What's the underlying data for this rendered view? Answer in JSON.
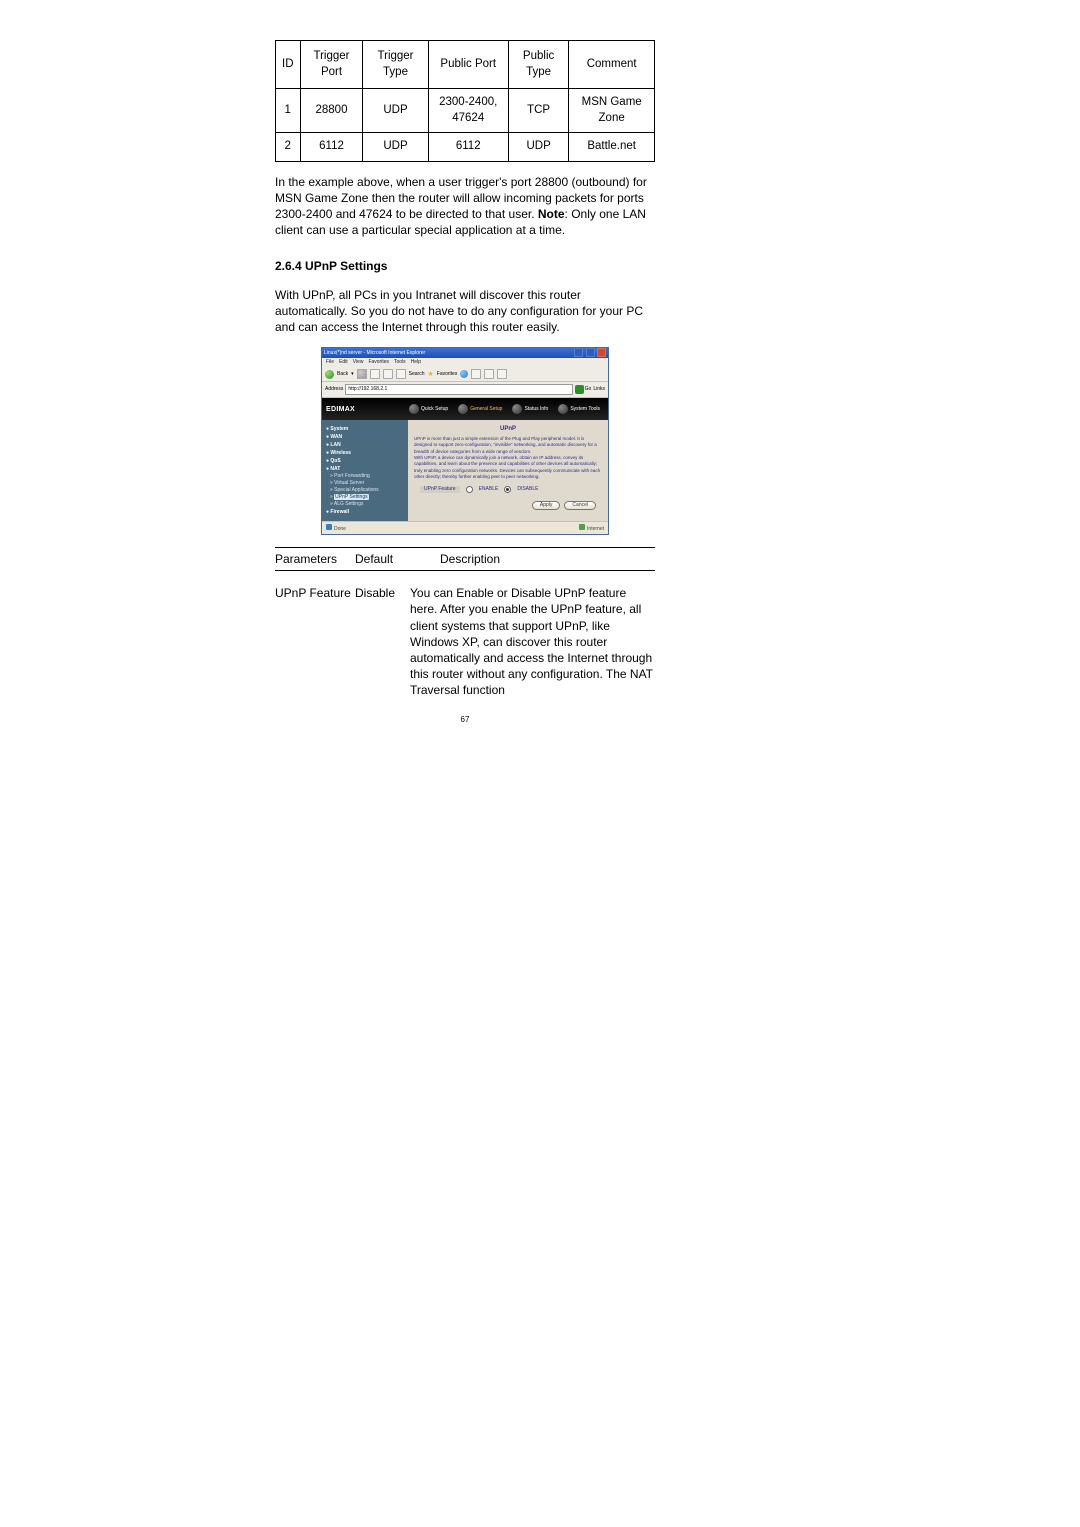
{
  "table": {
    "headers": [
      "ID",
      "Trigger Port",
      "Trigger Type",
      "Public Port",
      "Public Type",
      "Comment"
    ],
    "rows": [
      {
        "id": "1",
        "trigger_port": "28800",
        "trigger_type": "UDP",
        "public_port": "2300-2400, 47624",
        "public_type": "TCP",
        "comment": "MSN Game Zone"
      },
      {
        "id": "2",
        "trigger_port": "6112",
        "trigger_type": "UDP",
        "public_port": "6112",
        "public_type": "UDP",
        "comment": "Battle.net"
      }
    ]
  },
  "example_text_pre": "In the example above, when a user trigger's port 28800 (outbound) for MSN Game Zone then the router will allow incoming packets for ports 2300-2400 and 47624 to be directed to that user. ",
  "example_note_label": "Note",
  "example_text_post": ": Only one LAN client can use a particular special application at a time.",
  "section_title": "2.6.4 UPnP Settings",
  "upnp_intro": "With UPnP, all PCs in you Intranet will discover this router automatically. So you do not have to do any configuration for your PC and can access the Internet through this router easily.",
  "browser": {
    "title": "Linux(*)nd server - Microsoft Internet Explorer",
    "menu": [
      "File",
      "Edit",
      "View",
      "Favorites",
      "Tools",
      "Help"
    ],
    "toolbar": {
      "back": "Back",
      "search": "Search",
      "favorites": "Favorites"
    },
    "address_label": "Address",
    "address_value": "http://192.168.2.1",
    "go": "Go",
    "links": "Links",
    "brand": "EDIMAX",
    "tabs": [
      "Quick Setup",
      "General Setup",
      "Status Info",
      "System Tools"
    ],
    "sidebar": {
      "items": [
        {
          "label": "System",
          "type": "head"
        },
        {
          "label": "WAN",
          "type": "head"
        },
        {
          "label": "LAN",
          "type": "head"
        },
        {
          "label": "Wireless",
          "type": "head"
        },
        {
          "label": "QoS",
          "type": "head"
        },
        {
          "label": "NAT",
          "type": "head"
        },
        {
          "label": "Port Forwarding",
          "type": "sub"
        },
        {
          "label": "Virtual Server",
          "type": "sub"
        },
        {
          "label": "Special Applications",
          "type": "sub"
        },
        {
          "label": "UPnP Settings",
          "type": "sub-active"
        },
        {
          "label": "ALG Settings",
          "type": "sub"
        },
        {
          "label": "Firewall",
          "type": "head"
        }
      ]
    },
    "panel": {
      "title": "UPnP",
      "text": "UPnP is more than just a simple extension of the Plug and Play peripheral model. It is designed to support zero-configuration, \"invisible\" networking, and automatic discovery for a breadth of device categories from a wide range of vendors.\nWith UPnP, a device can dynamically join a network, obtain an IP address, convey its capabilities, and learn about the presence and capabilities of other devices all automatically; truly enabling zero configuration networks. Devices can subsequently communicate with each other directly; thereby further enabling peer to peer networking.",
      "setting_label": "UPnP Feature",
      "enable": "ENABLE",
      "disable": "DISABLE",
      "apply": "Apply",
      "cancel": "Cancel"
    },
    "status": {
      "done": "Done",
      "zone": "Internet"
    }
  },
  "params_header": {
    "p": "Parameters",
    "d": "Default",
    "desc": "Description"
  },
  "params_row": {
    "p": "UPnP Feature",
    "d": "Disable",
    "desc": "You can Enable or Disable UPnP feature here. After you enable the UPnP feature, all client systems that support UPnP, like Windows XP, can discover this router automatically and access the Internet through this router without any configuration. The NAT Traversal function"
  },
  "page_number": "67"
}
